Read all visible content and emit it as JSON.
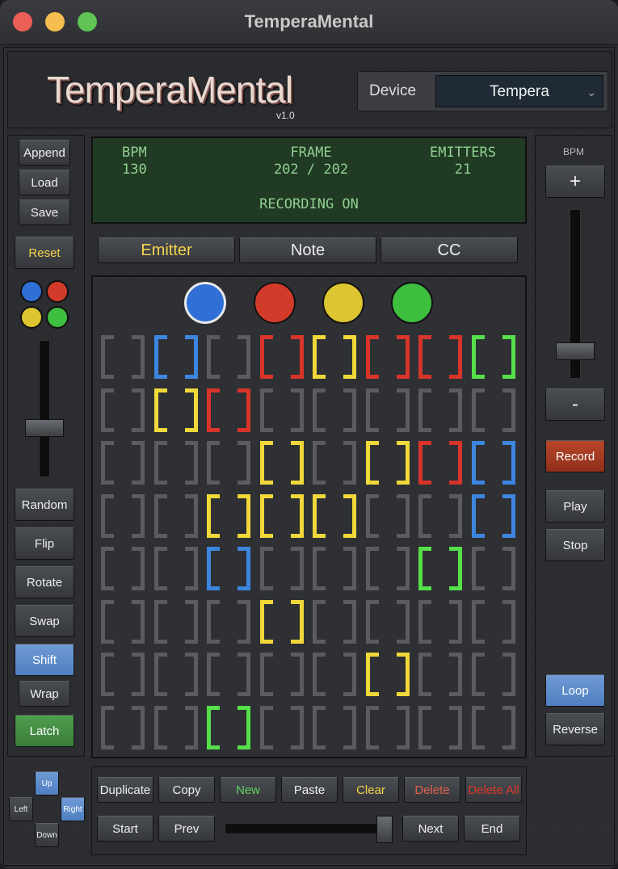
{
  "window": {
    "title": "TemperaMental"
  },
  "header": {
    "logo": "TemperaMental",
    "version": "v1.0",
    "device_label": "Device",
    "device_value": "Tempera"
  },
  "left_panel": {
    "buttons_top": [
      "Append",
      "Load",
      "Save"
    ],
    "reset": "Reset",
    "buttons_mid": [
      "Random",
      "Flip",
      "Rotate",
      "Swap",
      "Shift",
      "Wrap",
      "Latch"
    ],
    "emitter_colors": [
      "#2f6fd6",
      "#d23a2a",
      "#dcc530",
      "#3fbf3f"
    ]
  },
  "lcd": {
    "bpm_label": "BPM",
    "bpm_value": "130",
    "frame_label": "FRAME",
    "frame_value": "202 / 202",
    "emitters_label": "EMITTERS",
    "emitters_value": "21",
    "status": "RECORDING ON"
  },
  "tabs": [
    "Emitter",
    "Note",
    "CC"
  ],
  "grid": {
    "emitter_colors": [
      "#2f6fd6",
      "#d23a2a",
      "#dcc530",
      "#3fbf3f"
    ],
    "rows": [
      [
        "off",
        "blue",
        "off",
        "red",
        "yellow",
        "red",
        "red",
        "green"
      ],
      [
        "off",
        "yellow",
        "red",
        "off",
        "off",
        "off",
        "off",
        "off"
      ],
      [
        "off",
        "off",
        "off",
        "yellow",
        "off",
        "yellow",
        "red",
        "blue"
      ],
      [
        "off",
        "off",
        "yellow",
        "yellow",
        "yellow",
        "off",
        "off",
        "blue"
      ],
      [
        "off",
        "off",
        "blue",
        "off",
        "off",
        "off",
        "green",
        "off"
      ],
      [
        "off",
        "off",
        "off",
        "yellow",
        "off",
        "off",
        "off",
        "off"
      ],
      [
        "off",
        "off",
        "off",
        "off",
        "off",
        "yellow",
        "off",
        "off"
      ],
      [
        "off",
        "off",
        "green",
        "off",
        "off",
        "off",
        "off",
        "off"
      ]
    ],
    "palette": {
      "off": "#5a5c60",
      "blue": "#3d86e0",
      "red": "#d8342a",
      "yellow": "#f0d83a",
      "green": "#55e04a"
    }
  },
  "right_panel": {
    "bpm_label": "BPM",
    "plus": "+",
    "minus": "-",
    "record": "Record",
    "play": "Play",
    "stop": "Stop",
    "loop": "Loop",
    "reverse": "Reverse"
  },
  "dpad": {
    "up": "Up",
    "left": "Left",
    "right": "Right",
    "down": "Down"
  },
  "bottom": {
    "row1": [
      "Duplicate",
      "Copy",
      "New",
      "Paste",
      "Clear",
      "Delete",
      "Delete All"
    ],
    "row2": {
      "start": "Start",
      "prev": "Prev",
      "next": "Next",
      "end": "End"
    },
    "frame_slider": 1.0
  }
}
